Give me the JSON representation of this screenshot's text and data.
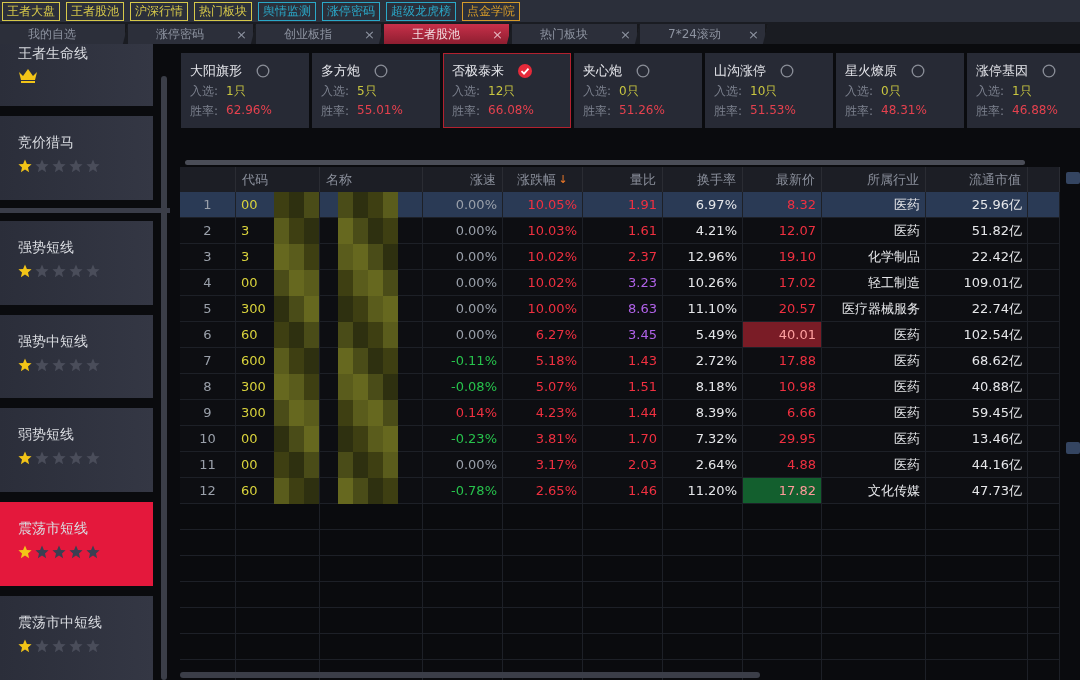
{
  "menu": [
    {
      "label": "王者大盘",
      "color": "#d6c84a"
    },
    {
      "label": "王者股池",
      "color": "#d6c84a"
    },
    {
      "label": "沪深行情",
      "color": "#d6c84a"
    },
    {
      "label": "热门板块",
      "color": "#d6c84a"
    },
    {
      "label": "舆情监测",
      "color": "#2aa8c8"
    },
    {
      "label": "涨停密码",
      "color": "#2aa8c8"
    },
    {
      "label": "超级龙虎榜",
      "color": "#2aa8c8"
    },
    {
      "label": "点金学院",
      "color": "#d49a2a"
    }
  ],
  "tabs": [
    {
      "label": "我的自选",
      "selected": false
    },
    {
      "label": "涨停密码",
      "close": "×",
      "selected": false
    },
    {
      "label": "创业板指",
      "close": "×",
      "selected": false
    },
    {
      "label": "王者股池",
      "close": "×",
      "selected": true
    },
    {
      "label": "热门板块",
      "close": "×",
      "selected": false
    },
    {
      "label": "7*24滚动",
      "close": "×",
      "selected": false
    }
  ],
  "sidebar": {
    "items": [
      {
        "label": "王者生命线",
        "kind": "crown",
        "selected": false
      },
      {
        "label": "竞价猎马",
        "kind": "stars",
        "stars": 1,
        "selected": false
      },
      {
        "label": "强势短线",
        "kind": "stars",
        "stars": 1,
        "selected": false
      },
      {
        "label": "强势中短线",
        "kind": "stars",
        "stars": 1,
        "selected": false
      },
      {
        "label": "弱势短线",
        "kind": "stars",
        "stars": 1,
        "selected": false
      },
      {
        "label": "震荡市短线",
        "kind": "stars",
        "stars": 1,
        "selected": true
      },
      {
        "label": "震荡市中短线",
        "kind": "stars",
        "stars": 1,
        "selected": false
      }
    ]
  },
  "strategies": [
    {
      "name": "大阳旗形",
      "picked_label": "入选:",
      "picked": "1只",
      "rate_label": "胜率:",
      "rate": "62.96%",
      "selected": false
    },
    {
      "name": "多方炮",
      "picked_label": "入选:",
      "picked": "5只",
      "rate_label": "胜率:",
      "rate": "55.01%",
      "selected": false
    },
    {
      "name": "否极泰来",
      "picked_label": "入选:",
      "picked": "12只",
      "rate_label": "胜率:",
      "rate": "66.08%",
      "selected": true
    },
    {
      "name": "夹心炮",
      "picked_label": "入选:",
      "picked": "0只",
      "rate_label": "胜率:",
      "rate": "51.26%",
      "selected": false
    },
    {
      "name": "山沟涨停",
      "picked_label": "入选:",
      "picked": "10只",
      "rate_label": "胜率:",
      "rate": "51.53%",
      "selected": false
    },
    {
      "name": "星火燎原",
      "picked_label": "入选:",
      "picked": "0只",
      "rate_label": "胜率:",
      "rate": "48.31%",
      "selected": false
    },
    {
      "name": "涨停基因",
      "picked_label": "入选:",
      "picked": "1只",
      "rate_label": "胜率:",
      "rate": "46.88%",
      "selected": false
    }
  ],
  "table": {
    "columns": [
      "代码",
      "名称",
      "涨速",
      "涨跌幅",
      "量比",
      "换手率",
      "最新价",
      "所属行业",
      "流通市值"
    ],
    "sort_mark": "↓",
    "rows": [
      {
        "no": "1",
        "code": "00",
        "speed": {
          "text": "0.00%",
          "color": "#9aa0aa"
        },
        "change": "10.05%",
        "ratio": {
          "text": "1.91",
          "color": "#f03040"
        },
        "turnover": "6.97%",
        "price": {
          "text": "8.32",
          "color": "#f03040"
        },
        "industry": "医药",
        "cap": "25.96亿",
        "selected": true
      },
      {
        "no": "2",
        "code": "3",
        "speed": {
          "text": "0.00%",
          "color": "#9aa0aa"
        },
        "change": "10.03%",
        "ratio": {
          "text": "1.61",
          "color": "#f03040"
        },
        "turnover": "4.21%",
        "price": {
          "text": "12.07",
          "color": "#f03040"
        },
        "industry": "医药",
        "cap": "51.82亿",
        "selected": false
      },
      {
        "no": "3",
        "code": "3",
        "speed": {
          "text": "0.00%",
          "color": "#9aa0aa"
        },
        "change": "10.02%",
        "ratio": {
          "text": "2.37",
          "color": "#f03040"
        },
        "turnover": "12.96%",
        "price": {
          "text": "19.10",
          "color": "#f03040"
        },
        "industry": "化学制品",
        "cap": "22.42亿",
        "selected": false
      },
      {
        "no": "4",
        "code": "00",
        "speed": {
          "text": "0.00%",
          "color": "#9aa0aa"
        },
        "change": "10.02%",
        "ratio": {
          "text": "3.23",
          "color": "#b062e8"
        },
        "turnover": "10.26%",
        "price": {
          "text": "17.02",
          "color": "#f03040"
        },
        "industry": "轻工制造",
        "cap": "109.01亿",
        "selected": false
      },
      {
        "no": "5",
        "code": "300",
        "speed": {
          "text": "0.00%",
          "color": "#9aa0aa"
        },
        "change": "10.00%",
        "ratio": {
          "text": "8.63",
          "color": "#b062e8"
        },
        "turnover": "11.10%",
        "price": {
          "text": "20.57",
          "color": "#f03040"
        },
        "industry": "医疗器械服务",
        "cap": "22.74亿",
        "selected": false
      },
      {
        "no": "6",
        "code": "60",
        "speed": {
          "text": "0.00%",
          "color": "#9aa0aa"
        },
        "change": "6.27%",
        "ratio": {
          "text": "3.45",
          "color": "#b062e8"
        },
        "turnover": "5.49%",
        "price": {
          "text": "40.01",
          "color": "#ffa0a0",
          "highlight": {
            "color": "#7a1c26"
          }
        },
        "industry": "医药",
        "cap": "102.54亿",
        "selected": false
      },
      {
        "no": "7",
        "code": "600",
        "speed": {
          "text": "-0.11%",
          "color": "#27c24c"
        },
        "change": "5.18%",
        "ratio": {
          "text": "1.43",
          "color": "#f03040"
        },
        "turnover": "2.72%",
        "price": {
          "text": "17.88",
          "color": "#f03040"
        },
        "industry": "医药",
        "cap": "68.62亿",
        "selected": false
      },
      {
        "no": "8",
        "code": "300",
        "speed": {
          "text": "-0.08%",
          "color": "#27c24c"
        },
        "change": "5.07%",
        "ratio": {
          "text": "1.51",
          "color": "#f03040"
        },
        "turnover": "8.18%",
        "price": {
          "text": "10.98",
          "color": "#f03040"
        },
        "industry": "医药",
        "cap": "40.88亿",
        "selected": false
      },
      {
        "no": "9",
        "code": "300",
        "speed": {
          "text": "0.14%",
          "color": "#f03040"
        },
        "change": "4.23%",
        "ratio": {
          "text": "1.44",
          "color": "#f03040"
        },
        "turnover": "8.39%",
        "price": {
          "text": "6.66",
          "color": "#f03040"
        },
        "industry": "医药",
        "cap": "59.45亿",
        "selected": false
      },
      {
        "no": "10",
        "code": "00",
        "speed": {
          "text": "-0.23%",
          "color": "#27c24c"
        },
        "change": "3.81%",
        "ratio": {
          "text": "1.70",
          "color": "#f03040"
        },
        "turnover": "7.32%",
        "price": {
          "text": "29.95",
          "color": "#f03040"
        },
        "industry": "医药",
        "cap": "13.46亿",
        "selected": false
      },
      {
        "no": "11",
        "code": "00",
        "speed": {
          "text": "0.00%",
          "color": "#9aa0aa"
        },
        "change": "3.17%",
        "ratio": {
          "text": "2.03",
          "color": "#f03040"
        },
        "turnover": "2.64%",
        "price": {
          "text": "4.88",
          "color": "#f03040"
        },
        "industry": "医药",
        "cap": "44.16亿",
        "selected": false
      },
      {
        "no": "12",
        "code": "60",
        "speed": {
          "text": "-0.78%",
          "color": "#27c24c"
        },
        "change": "2.65%",
        "ratio": {
          "text": "1.46",
          "color": "#f03040"
        },
        "turnover": "11.20%",
        "price": {
          "text": "17.82",
          "color": "#ff9a9a",
          "highlight": {
            "color": "#135f2e"
          }
        },
        "industry": "文化传媒",
        "cap": "47.73亿",
        "selected": false
      }
    ]
  }
}
